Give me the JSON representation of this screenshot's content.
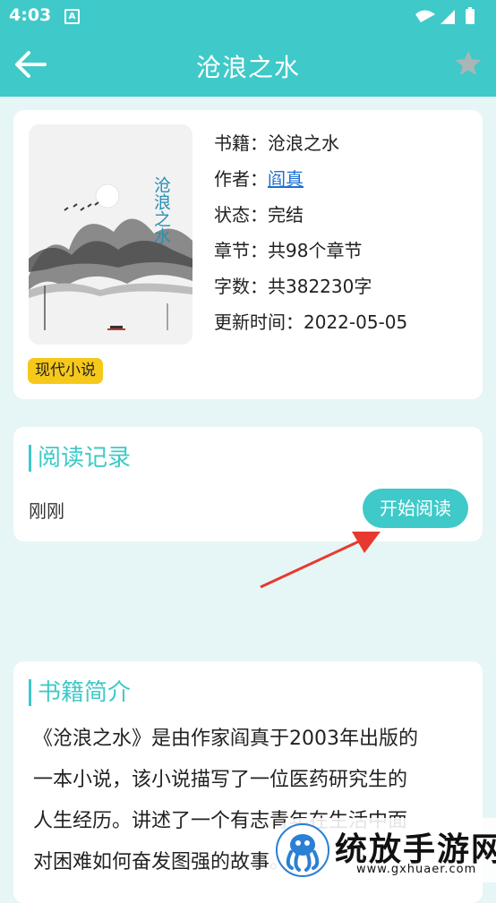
{
  "status_bar": {
    "time": "4:03",
    "notification_icon": "A"
  },
  "app_bar": {
    "title": "沧浪之水",
    "back_icon": "arrow-left-icon",
    "favorite_icon": "star-icon"
  },
  "book": {
    "cover_title": "沧浪之水",
    "rows": [
      {
        "label": "书籍：",
        "value": "沧浪之水"
      },
      {
        "label": "作者：",
        "value": "阎真"
      },
      {
        "label": "状态：",
        "value": "完结"
      },
      {
        "label": "章节：",
        "value": "共98个章节"
      },
      {
        "label": "字数：",
        "value": "共382230字"
      },
      {
        "label": "更新时间：",
        "value": "2022-05-05"
      }
    ],
    "genre_tag": "现代小说"
  },
  "reading": {
    "title": "阅读记录",
    "last_read": "刚刚",
    "start_button": "开始阅读"
  },
  "intro": {
    "title": "书籍简介",
    "lines": [
      "《沧浪之水》是由作家阎真于2003年出版的",
      "一本小说，该小说描写了一位医药研究生的",
      "人生经历。讲述了一个有志青年在生活中面",
      "对困难如何奋发图强的故事。"
    ]
  },
  "watermark": {
    "title": "统放手游网",
    "url": "www.gxhuaer.com"
  },
  "colors": {
    "accent": "#3fc9c9",
    "tag": "#f6c81a",
    "link": "#1e6fd0",
    "annotation_arrow": "#e8392f"
  }
}
